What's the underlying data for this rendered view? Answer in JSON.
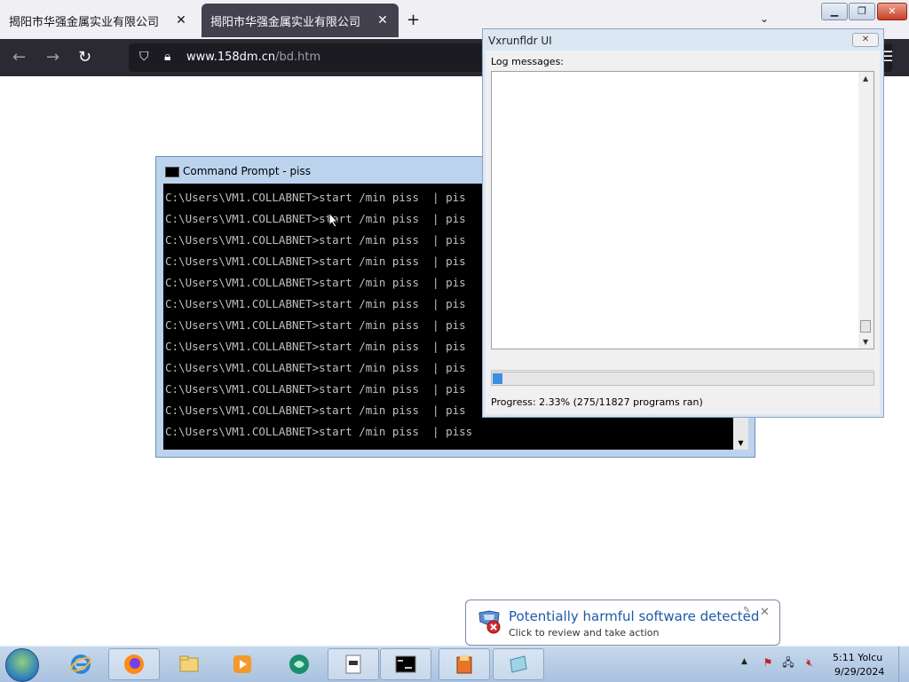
{
  "browser": {
    "tabs": [
      {
        "label": "揭阳市华强金属实业有限公司",
        "active": false
      },
      {
        "label": "揭阳市华强金属实业有限公司",
        "active": true
      }
    ],
    "new_tab": "+",
    "url": {
      "domain": "www.158dm.cn",
      "path": "/bd.htm"
    }
  },
  "cmd": {
    "title": "Command Prompt - piss",
    "lines": [
      "C:\\Users\\VM1.COLLABNET>start /min piss  | pis",
      "C:\\Users\\VM1.COLLABNET>start /min piss  | pis",
      "C:\\Users\\VM1.COLLABNET>start /min piss  | pis",
      "C:\\Users\\VM1.COLLABNET>start /min piss  | pis",
      "C:\\Users\\VM1.COLLABNET>start /min piss  | pis",
      "C:\\Users\\VM1.COLLABNET>start /min piss  | pis",
      "C:\\Users\\VM1.COLLABNET>start /min piss  | pis",
      "C:\\Users\\VM1.COLLABNET>start /min piss  | pis",
      "C:\\Users\\VM1.COLLABNET>start /min piss  | pis",
      "C:\\Users\\VM1.COLLABNET>start /min piss  | pis",
      "C:\\Users\\VM1.COLLABNET>start /min piss  | pis",
      "C:\\Users\\VM1.COLLABNET>start /min piss  | piss"
    ]
  },
  "vx": {
    "title": "Vxrunfldr UI",
    "log_label": "Log messages:",
    "progress_fraction": 0.0233,
    "progress_text": "Progress: 2.33% (275/11827 programs ran)"
  },
  "notification": {
    "title": "Potentially harmful software detected",
    "subtitle": "Click to review and take action"
  },
  "taskbar": {
    "time": "5:11 Yolcu",
    "date": "9/29/2024"
  },
  "colors": {
    "browser_dark": "#2b2a33",
    "progress": "#3b8fe2",
    "notification_title": "#1e5aa8"
  }
}
